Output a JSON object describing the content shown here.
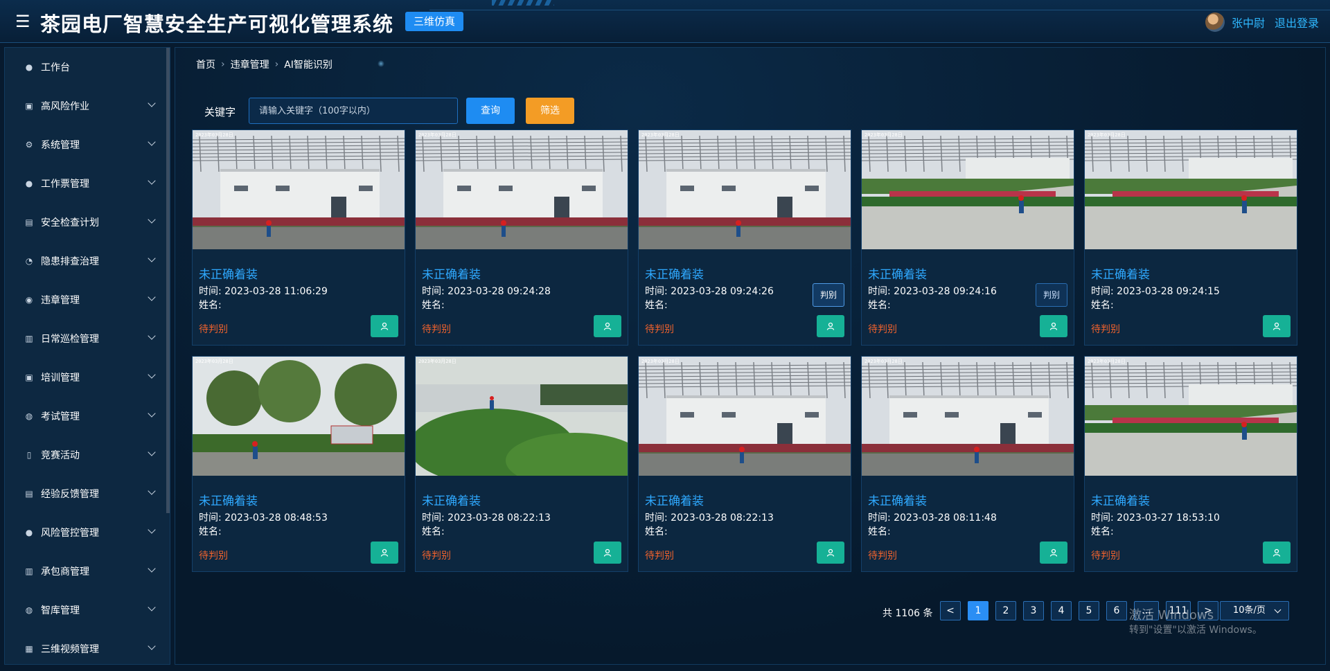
{
  "header": {
    "title": "茶园电厂智慧安全生产可视化管理系统",
    "sim_button": "三维仿真",
    "user_name": "张中尉",
    "logout": "退出登录"
  },
  "sidebar": {
    "items": [
      {
        "label": "工作台",
        "icon": "user-icon",
        "expandable": false
      },
      {
        "label": "高风险作业",
        "icon": "chart-icon",
        "expandable": true
      },
      {
        "label": "系统管理",
        "icon": "gear-icon",
        "expandable": true
      },
      {
        "label": "工作票管理",
        "icon": "user-icon",
        "expandable": true
      },
      {
        "label": "安全检查计划",
        "icon": "briefcase-icon",
        "expandable": true
      },
      {
        "label": "隐患排查治理",
        "icon": "bell-icon",
        "expandable": true
      },
      {
        "label": "违章管理",
        "icon": "eye-icon",
        "expandable": true
      },
      {
        "label": "日常巡检管理",
        "icon": "bars-icon",
        "expandable": true
      },
      {
        "label": "培训管理",
        "icon": "chart-icon",
        "expandable": true
      },
      {
        "label": "考试管理",
        "icon": "bulb-icon",
        "expandable": true
      },
      {
        "label": "竞赛活动",
        "icon": "bookmark-icon",
        "expandable": true
      },
      {
        "label": "经验反馈管理",
        "icon": "briefcase-icon",
        "expandable": true
      },
      {
        "label": "风险管控管理",
        "icon": "user-icon",
        "expandable": true
      },
      {
        "label": "承包商管理",
        "icon": "bars-icon",
        "expandable": true
      },
      {
        "label": "智库管理",
        "icon": "bulb-icon",
        "expandable": true
      },
      {
        "label": "三维视频管理",
        "icon": "grid-icon",
        "expandable": true
      }
    ]
  },
  "breadcrumb": {
    "home": "首页",
    "level2": "违章管理",
    "level3": "AI智能识别"
  },
  "search": {
    "label": "关键字",
    "placeholder": "请输入关键字（100字以内）",
    "query_button": "查询",
    "filter_button": "筛选"
  },
  "cards": [
    {
      "title": "未正确着装",
      "time": "时间:  2023-03-28 11:06:29",
      "name": "姓名:",
      "status": "待判别",
      "judge": ""
    },
    {
      "title": "未正确着装",
      "time": "时间:  2023-03-28 09:24:28",
      "name": "姓名:",
      "status": "待判别",
      "judge": ""
    },
    {
      "title": "未正确着装",
      "time": "时间:  2023-03-28 09:24:26",
      "name": "姓名:",
      "status": "待判别",
      "judge": "判别"
    },
    {
      "title": "未正确着装",
      "time": "时间:  2023-03-28 09:24:16",
      "name": "姓名:",
      "status": "待判别",
      "judge": "判别"
    },
    {
      "title": "未正确着装",
      "time": "时间:  2023-03-28 09:24:15",
      "name": "姓名:",
      "status": "待判别",
      "judge": ""
    },
    {
      "title": "未正确着装",
      "time": "时间:  2023-03-28 08:48:53",
      "name": "姓名:",
      "status": "待判别",
      "judge": ""
    },
    {
      "title": "未正确着装",
      "time": "时间:  2023-03-28 08:22:13",
      "name": "姓名:",
      "status": "待判别",
      "judge": ""
    },
    {
      "title": "未正确着装",
      "time": "时间:  2023-03-28 08:22:13",
      "name": "姓名:",
      "status": "待判别",
      "judge": ""
    },
    {
      "title": "未正确着装",
      "time": "时间:  2023-03-28 08:11:48",
      "name": "姓名:",
      "status": "待判别",
      "judge": ""
    },
    {
      "title": "未正确着装",
      "time": "时间:  2023-03-27 18:53:10",
      "name": "姓名:",
      "status": "待判别",
      "judge": ""
    }
  ],
  "pagination": {
    "total": "共 1106 条",
    "prev": "<",
    "pages": [
      "1",
      "2",
      "3",
      "4",
      "5",
      "6",
      "...",
      "111"
    ],
    "next": ">",
    "page_size": "10条/页",
    "current": "1"
  },
  "watermark": {
    "line1": "激活 Windows",
    "line2": "转到\"设置\"以激活 Windows。"
  },
  "colors": {
    "accent": "#1e8cf2",
    "filter": "#f39c25",
    "status_pending": "#f0622d",
    "title_blue": "#2fa9ff",
    "user_button": "#16b196"
  }
}
